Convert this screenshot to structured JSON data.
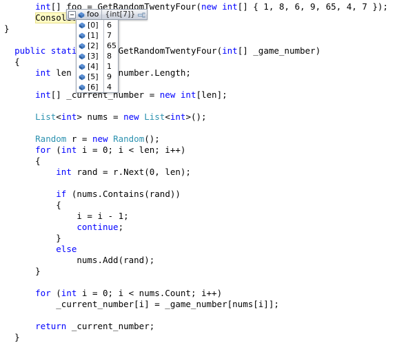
{
  "editor": {
    "language": "csharp",
    "colors": {
      "keyword": "#0000ff",
      "type": "#2b91af",
      "text": "#000000",
      "background": "#ffffff",
      "current_statement_highlight": "#fffbc4"
    },
    "lines": [
      {
        "indent": 6,
        "segments": [
          {
            "t": "int",
            "c": "kw"
          },
          {
            "t": "[] foo = GetRandomTwentyFour(",
            "c": "pln"
          },
          {
            "t": "new",
            "c": "kw"
          },
          {
            "t": " ",
            "c": "pln"
          },
          {
            "t": "int",
            "c": "kw"
          },
          {
            "t": "[] { 1, 8, 6, 9, 65, 4, 7 });",
            "c": "pln"
          }
        ]
      },
      {
        "indent": 6,
        "highlight": "Console.",
        "segments": []
      },
      {
        "indent": 0,
        "segments": [
          {
            "t": "}",
            "c": "pln"
          }
        ]
      },
      {
        "indent": 0,
        "segments": []
      },
      {
        "indent": 2,
        "segments": [
          {
            "t": "public",
            "c": "kw"
          },
          {
            "t": " ",
            "c": "pln"
          },
          {
            "t": "static",
            "c": "kw"
          },
          {
            "t": " ",
            "c": "pln"
          },
          {
            "t": "int",
            "c": "kw"
          },
          {
            "t": "[] GetRandomTwentyFour(",
            "c": "pln"
          },
          {
            "t": "int",
            "c": "kw"
          },
          {
            "t": "[] _game_number)",
            "c": "pln"
          }
        ]
      },
      {
        "indent": 2,
        "segments": [
          {
            "t": "{",
            "c": "pln"
          }
        ]
      },
      {
        "indent": 6,
        "segments": [
          {
            "t": "int",
            "c": "kw"
          },
          {
            "t": " len = _game_number.Length;",
            "c": "pln"
          }
        ]
      },
      {
        "indent": 0,
        "segments": []
      },
      {
        "indent": 6,
        "segments": [
          {
            "t": "int",
            "c": "kw"
          },
          {
            "t": "[] _current_number = ",
            "c": "pln"
          },
          {
            "t": "new",
            "c": "kw"
          },
          {
            "t": " ",
            "c": "pln"
          },
          {
            "t": "int",
            "c": "kw"
          },
          {
            "t": "[len];",
            "c": "pln"
          }
        ]
      },
      {
        "indent": 0,
        "segments": []
      },
      {
        "indent": 6,
        "segments": [
          {
            "t": "List",
            "c": "typ"
          },
          {
            "t": "<",
            "c": "pln"
          },
          {
            "t": "int",
            "c": "kw"
          },
          {
            "t": "> nums = ",
            "c": "pln"
          },
          {
            "t": "new",
            "c": "kw"
          },
          {
            "t": " ",
            "c": "pln"
          },
          {
            "t": "List",
            "c": "typ"
          },
          {
            "t": "<",
            "c": "pln"
          },
          {
            "t": "int",
            "c": "kw"
          },
          {
            "t": ">();",
            "c": "pln"
          }
        ]
      },
      {
        "indent": 0,
        "segments": []
      },
      {
        "indent": 6,
        "segments": [
          {
            "t": "Random",
            "c": "typ"
          },
          {
            "t": " r = ",
            "c": "pln"
          },
          {
            "t": "new",
            "c": "kw"
          },
          {
            "t": " ",
            "c": "pln"
          },
          {
            "t": "Random",
            "c": "typ"
          },
          {
            "t": "();",
            "c": "pln"
          }
        ]
      },
      {
        "indent": 6,
        "segments": [
          {
            "t": "for",
            "c": "kw"
          },
          {
            "t": " (",
            "c": "pln"
          },
          {
            "t": "int",
            "c": "kw"
          },
          {
            "t": " i = 0; i < len; i++)",
            "c": "pln"
          }
        ]
      },
      {
        "indent": 6,
        "segments": [
          {
            "t": "{",
            "c": "pln"
          }
        ]
      },
      {
        "indent": 10,
        "segments": [
          {
            "t": "int",
            "c": "kw"
          },
          {
            "t": " rand = r.Next(0, len);",
            "c": "pln"
          }
        ]
      },
      {
        "indent": 0,
        "segments": []
      },
      {
        "indent": 10,
        "segments": [
          {
            "t": "if",
            "c": "kw"
          },
          {
            "t": " (nums.Contains(rand))",
            "c": "pln"
          }
        ]
      },
      {
        "indent": 10,
        "segments": [
          {
            "t": "{",
            "c": "pln"
          }
        ]
      },
      {
        "indent": 14,
        "segments": [
          {
            "t": "i = i - 1;",
            "c": "pln"
          }
        ]
      },
      {
        "indent": 14,
        "segments": [
          {
            "t": "continue",
            "c": "kw"
          },
          {
            "t": ";",
            "c": "pln"
          }
        ]
      },
      {
        "indent": 10,
        "segments": [
          {
            "t": "}",
            "c": "pln"
          }
        ]
      },
      {
        "indent": 10,
        "segments": [
          {
            "t": "else",
            "c": "kw"
          }
        ]
      },
      {
        "indent": 14,
        "segments": [
          {
            "t": "nums.Add(rand);",
            "c": "pln"
          }
        ]
      },
      {
        "indent": 6,
        "segments": [
          {
            "t": "}",
            "c": "pln"
          }
        ]
      },
      {
        "indent": 0,
        "segments": []
      },
      {
        "indent": 6,
        "segments": [
          {
            "t": "for",
            "c": "kw"
          },
          {
            "t": " (",
            "c": "pln"
          },
          {
            "t": "int",
            "c": "kw"
          },
          {
            "t": " i = 0; i < nums.Count; i++)",
            "c": "pln"
          }
        ]
      },
      {
        "indent": 10,
        "segments": [
          {
            "t": "_current_number[i] = _game_number[nums[i]];",
            "c": "pln"
          }
        ]
      },
      {
        "indent": 0,
        "segments": []
      },
      {
        "indent": 6,
        "segments": [
          {
            "t": "return",
            "c": "kw"
          },
          {
            "t": " _current_number;",
            "c": "pln"
          }
        ]
      },
      {
        "indent": 2,
        "segments": [
          {
            "t": "}",
            "c": "pln"
          }
        ]
      }
    ]
  },
  "datatip": {
    "expander_state": "expanded",
    "icon": "field-icon",
    "name": "foo",
    "value": "{int[7]}",
    "pin_icon": "pin-icon",
    "rows": [
      {
        "icon": "field-icon",
        "name": "[0]",
        "value": "6"
      },
      {
        "icon": "field-icon",
        "name": "[1]",
        "value": "7"
      },
      {
        "icon": "field-icon",
        "name": "[2]",
        "value": "65"
      },
      {
        "icon": "field-icon",
        "name": "[3]",
        "value": "8"
      },
      {
        "icon": "field-icon",
        "name": "[4]",
        "value": "1"
      },
      {
        "icon": "field-icon",
        "name": "[5]",
        "value": "9"
      },
      {
        "icon": "field-icon",
        "name": "[6]",
        "value": "4"
      }
    ]
  }
}
